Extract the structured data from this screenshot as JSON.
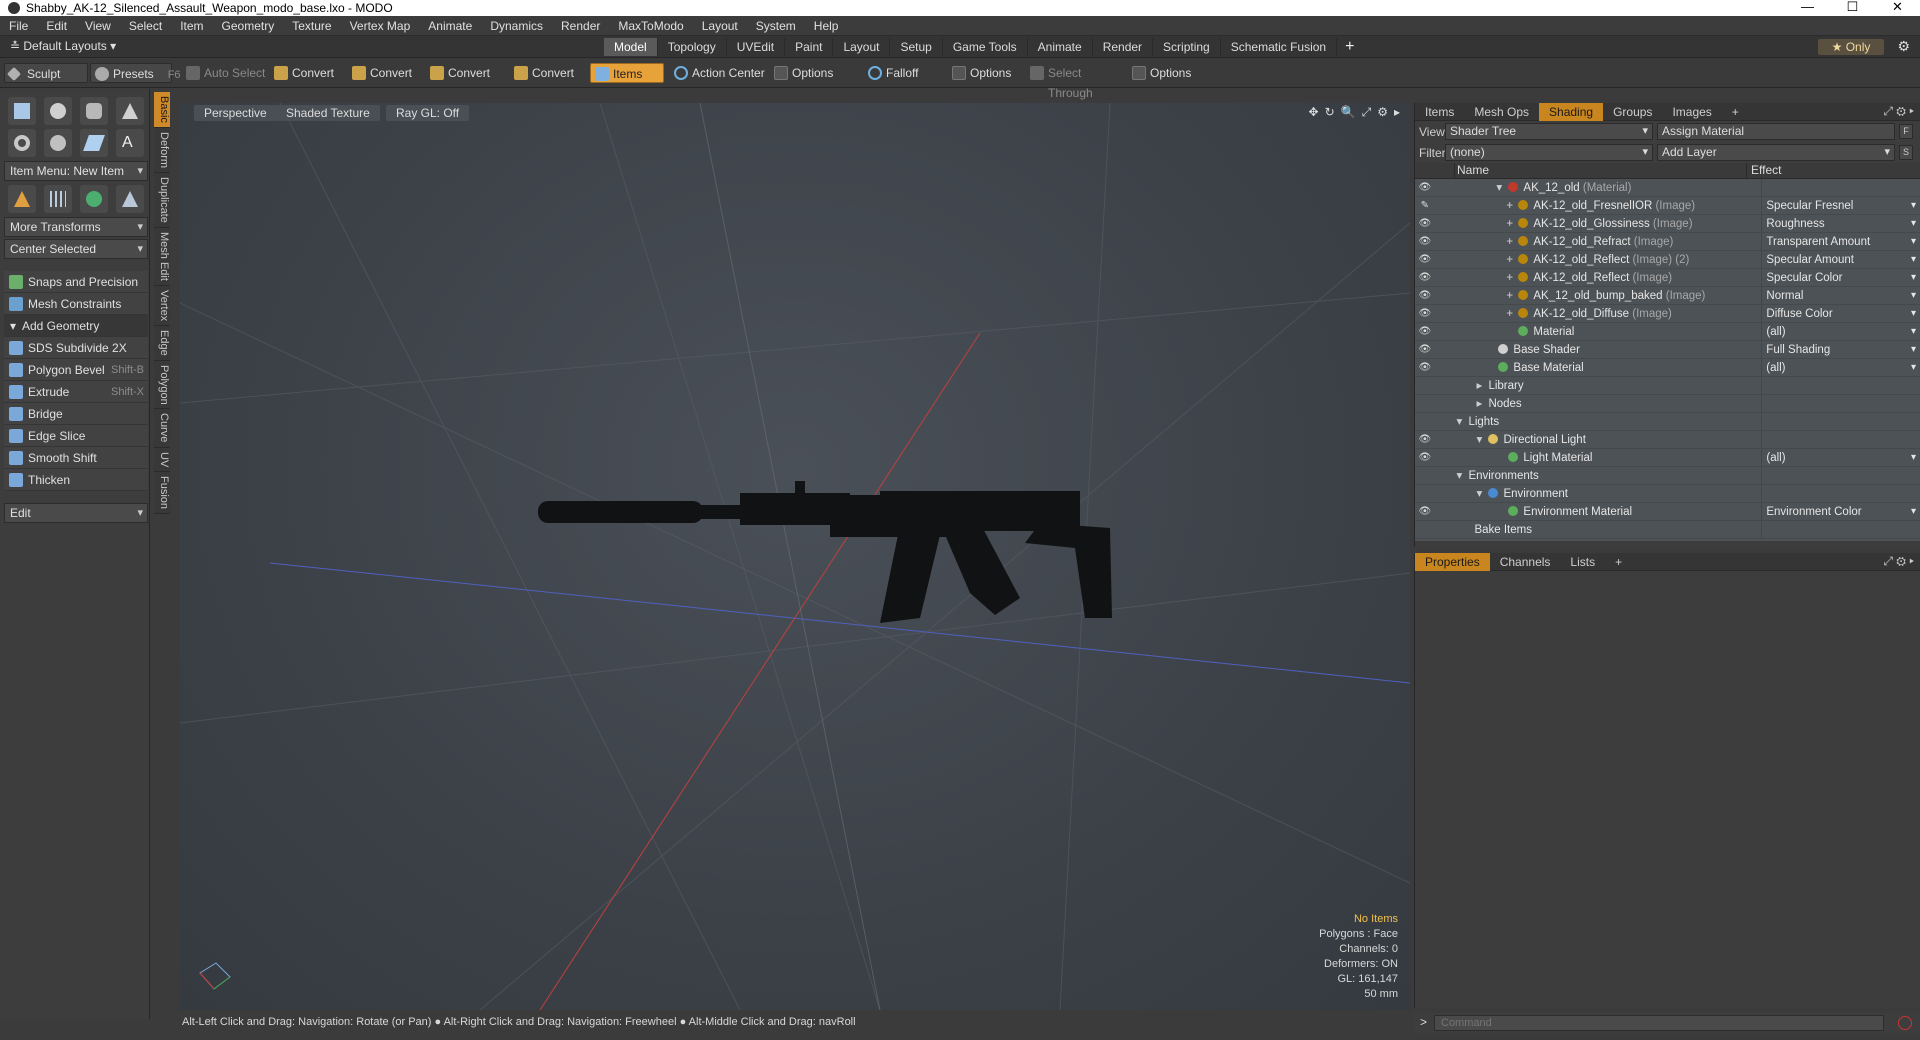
{
  "window": {
    "title": "Shabby_AK-12_Silenced_Assault_Weapon_modo_base.lxo - MODO",
    "min": "—",
    "max": "☐",
    "close": "✕"
  },
  "menu": [
    "File",
    "Edit",
    "View",
    "Select",
    "Item",
    "Geometry",
    "Texture",
    "Vertex Map",
    "Animate",
    "Dynamics",
    "Render",
    "MaxToModo",
    "Layout",
    "System",
    "Help"
  ],
  "layout": {
    "dropdown": "Default Layouts",
    "tabs": [
      "Model",
      "Topology",
      "UVEdit",
      "Paint",
      "Layout",
      "Setup",
      "Game Tools",
      "Animate",
      "Render",
      "Scripting",
      "Schematic Fusion"
    ],
    "active_tab": "Model",
    "plus": "+",
    "only": "★ Only"
  },
  "toolbar": {
    "sculpt": "Sculpt",
    "presets": "Presets",
    "presets_key": "F6",
    "auto_select": "Auto Select",
    "convert1": "Convert",
    "convert2": "Convert",
    "convert3": "Convert",
    "convert4": "Convert",
    "items": "Items",
    "action_center": "Action Center",
    "options1": "Options",
    "falloff": "Falloff",
    "options2": "Options",
    "select_through": "Select Through",
    "options3": "Options"
  },
  "left": {
    "item_menu": "Item Menu: New Item",
    "more_transforms": "More Transforms",
    "center_selected": "Center Selected",
    "snaps": "Snaps and Precision",
    "mesh_constraints": "Mesh Constraints",
    "add_geometry": "Add Geometry",
    "tools": [
      {
        "label": "SDS Subdivide 2X",
        "key": ""
      },
      {
        "label": "Polygon Bevel",
        "key": "Shift-B"
      },
      {
        "label": "Extrude",
        "key": "Shift-X"
      },
      {
        "label": "Bridge",
        "key": ""
      },
      {
        "label": "Edge Slice",
        "key": ""
      },
      {
        "label": "Smooth Shift",
        "key": ""
      },
      {
        "label": "Thicken",
        "key": ""
      }
    ],
    "edit": "Edit",
    "vtabs": [
      "Basic",
      "Deform",
      "Duplicate",
      "Mesh Edit",
      "Vertex",
      "Edge",
      "Polygon",
      "Curve",
      "UV",
      "Fusion"
    ]
  },
  "viewport": {
    "view": "Perspective",
    "shading": "Shaded Texture",
    "raygl": "Ray GL: Off",
    "stats": [
      "No Items",
      "Polygons : Face",
      "Channels: 0",
      "Deformers: ON",
      "GL: 161,147",
      "50 mm"
    ],
    "status": "Alt-Left Click and Drag: Navigation: Rotate (or Pan) ● Alt-Right Click and Drag: Navigation: Freewheel ● Alt-Middle Click and Drag: navRoll"
  },
  "shading": {
    "tabs": [
      "Items",
      "Mesh Ops",
      "Shading",
      "Groups",
      "Images",
      "+"
    ],
    "active_tab": "Shading",
    "view_label": "View",
    "view_value": "Shader Tree",
    "assign": "Assign Material",
    "f": "F",
    "filter_label": "Filter",
    "filter_value": "(none)",
    "add_layer": "Add Layer",
    "s": "S",
    "col_name": "Name",
    "col_effect": "Effect",
    "rows": [
      {
        "eye": "👁",
        "indent": 60,
        "tw": "▾",
        "icon": "#c0392b",
        "name": "AK_12_old",
        "tag": " (Material)",
        "effect": ""
      },
      {
        "eye": "✎",
        "indent": 70,
        "tw": "+",
        "icon": "#b8860b",
        "name": "AK-12_old_FresnelIOR",
        "tag": " (Image)",
        "effect": "Specular Fresnel"
      },
      {
        "eye": "👁",
        "indent": 70,
        "tw": "+",
        "icon": "#b8860b",
        "name": "AK-12_old_Glossiness",
        "tag": " (Image)",
        "effect": "Roughness"
      },
      {
        "eye": "👁",
        "indent": 70,
        "tw": "+",
        "icon": "#b8860b",
        "name": "AK-12_old_Refract",
        "tag": " (Image)",
        "effect": "Transparent Amount"
      },
      {
        "eye": "👁",
        "indent": 70,
        "tw": "+",
        "icon": "#b8860b",
        "name": "AK-12_old_Reflect",
        "tag": " (Image) (2)",
        "effect": "Specular Amount"
      },
      {
        "eye": "👁",
        "indent": 70,
        "tw": "+",
        "icon": "#b8860b",
        "name": "AK-12_old_Reflect",
        "tag": " (Image)",
        "effect": "Specular Color"
      },
      {
        "eye": "👁",
        "indent": 70,
        "tw": "+",
        "icon": "#b8860b",
        "name": "AK_12_old_bump_baked",
        "tag": " (Image)",
        "effect": "Normal"
      },
      {
        "eye": "👁",
        "indent": 70,
        "tw": "+",
        "icon": "#b8860b",
        "name": "AK-12_old_Diffuse",
        "tag": " (Image)",
        "effect": "Diffuse Color"
      },
      {
        "eye": "👁",
        "indent": 70,
        "tw": "",
        "icon": "#5cae5c",
        "name": "Material",
        "tag": "",
        "effect": "(all)"
      },
      {
        "eye": "👁",
        "indent": 50,
        "tw": "",
        "icon": "#d0d0d0",
        "name": "Base Shader",
        "tag": "",
        "effect": "Full Shading"
      },
      {
        "eye": "👁",
        "indent": 50,
        "tw": "",
        "icon": "#5cae5c",
        "name": "Base Material",
        "tag": "",
        "effect": "(all)"
      },
      {
        "eye": "",
        "indent": 40,
        "tw": "▸",
        "icon": "",
        "name": "Library",
        "tag": "",
        "effect": ""
      },
      {
        "eye": "",
        "indent": 40,
        "tw": "▸",
        "icon": "",
        "name": "Nodes",
        "tag": "",
        "effect": ""
      },
      {
        "eye": "",
        "indent": 20,
        "tw": "▾",
        "icon": "",
        "name": "Lights",
        "tag": "",
        "effect": ""
      },
      {
        "eye": "👁",
        "indent": 40,
        "tw": "▾",
        "icon": "#e0c060",
        "name": "Directional Light",
        "tag": "",
        "effect": ""
      },
      {
        "eye": "👁",
        "indent": 60,
        "tw": "",
        "icon": "#5cae5c",
        "name": "Light Material",
        "tag": "",
        "effect": "(all)"
      },
      {
        "eye": "",
        "indent": 20,
        "tw": "▾",
        "icon": "",
        "name": "Environments",
        "tag": "",
        "effect": ""
      },
      {
        "eye": "",
        "indent": 40,
        "tw": "▾",
        "icon": "#4a8ad0",
        "name": "Environment",
        "tag": "",
        "effect": ""
      },
      {
        "eye": "👁",
        "indent": 60,
        "tw": "",
        "icon": "#5cae5c",
        "name": "Environment Material",
        "tag": "",
        "effect": "Environment Color"
      },
      {
        "eye": "",
        "indent": 26,
        "tw": "",
        "icon": "",
        "name": "Bake Items",
        "tag": "",
        "effect": ""
      }
    ]
  },
  "properties": {
    "tabs": [
      "Properties",
      "Channels",
      "Lists",
      "+"
    ],
    "active_tab": "Properties"
  },
  "command": {
    "placeholder": "Command"
  }
}
